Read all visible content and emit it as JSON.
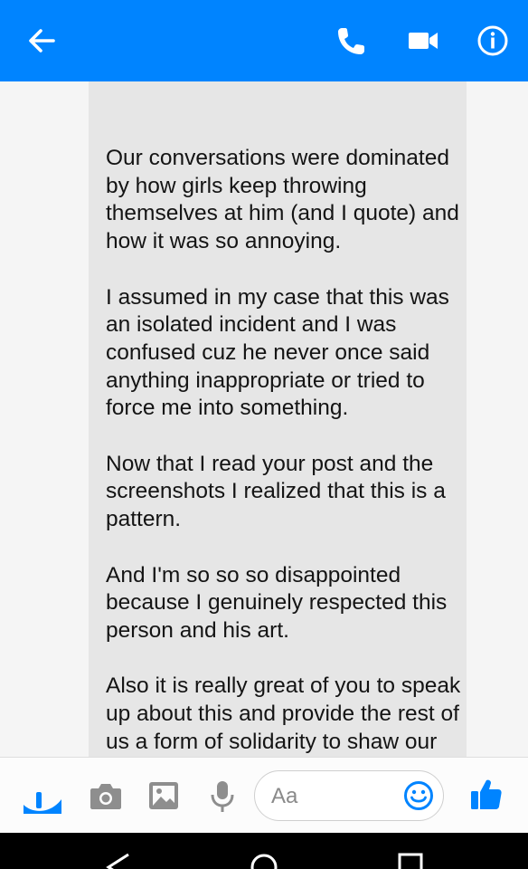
{
  "header": {
    "background": "#0084ff",
    "icons": [
      "back-arrow-icon",
      "phone-icon",
      "video-camera-icon",
      "info-icon"
    ]
  },
  "message": {
    "bubble_color": "#e6e6e6",
    "lines_partial_top": "Our conversations were",
    "paragraphs": [
      "Our conversations were dominated by how girls keep throwing themselves at him (and I quote) and how it was so annoying.",
      "I assumed in my case that this was an isolated incident and I was confused cuz he never once said anything inappropriate or tried to force me into something.",
      "Now that I read your post and the screenshots I realized that this is a pattern.",
      "And I'm so so so disappointed because I genuinely respected this person and his art.",
      "Also it is really great of you to speak up about this and provide the rest of us a form of solidarity to shaw our bits."
    ]
  },
  "composer": {
    "placeholder": "Aa",
    "accent": "#0084ff",
    "icons": [
      "more-icon",
      "camera-icon",
      "gallery-icon",
      "microphone-icon",
      "emoji-icon",
      "thumbs-up-icon"
    ]
  },
  "system_nav": {
    "icons": [
      "nav-back-icon",
      "nav-home-icon",
      "nav-recents-icon"
    ]
  }
}
